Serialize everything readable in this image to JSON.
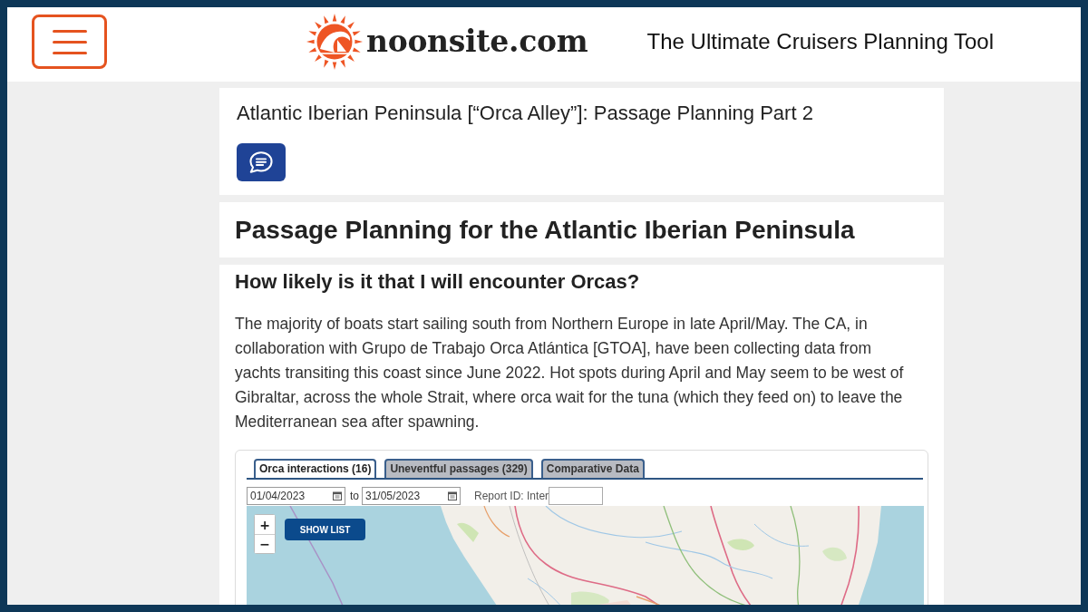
{
  "header": {
    "logo_text": "noonsite.com",
    "tagline": "The Ultimate Cruisers Planning Tool"
  },
  "article": {
    "title": "Atlantic Iberian Peninsula [“Orca Alley”]: Passage Planning Part 2"
  },
  "section": {
    "title": "Passage Planning for the Atlantic Iberian Peninsula"
  },
  "content": {
    "heading": "How likely is it that I will encounter Orcas?",
    "paragraph": "The majority of boats start sailing south from Northern Europe in late April/May. The CA, in collaboration with Grupo de Trabajo Orca Atlántica [GTOA], have been collecting data from yachts transiting this coast since June 2022. Hot spots during April and May seem to be west of Gibraltar, across the whole Strait, where orca wait for the tuna (which they feed on) to leave the Mediterranean sea after spawning."
  },
  "widget": {
    "tabs": [
      {
        "label": "Orca interactions (16)",
        "selected": true
      },
      {
        "label": "Uneventful passages (329)",
        "selected": false
      },
      {
        "label": "Comparative Data",
        "selected": false
      }
    ],
    "filters": {
      "date_from": "01/04/2023",
      "to_label": "to",
      "date_to": "31/05/2023",
      "report_id_label": "Report ID: Inter"
    },
    "map": {
      "zoom_in": "+",
      "zoom_out": "−",
      "show_list_button": "SHOW LIST"
    }
  }
}
